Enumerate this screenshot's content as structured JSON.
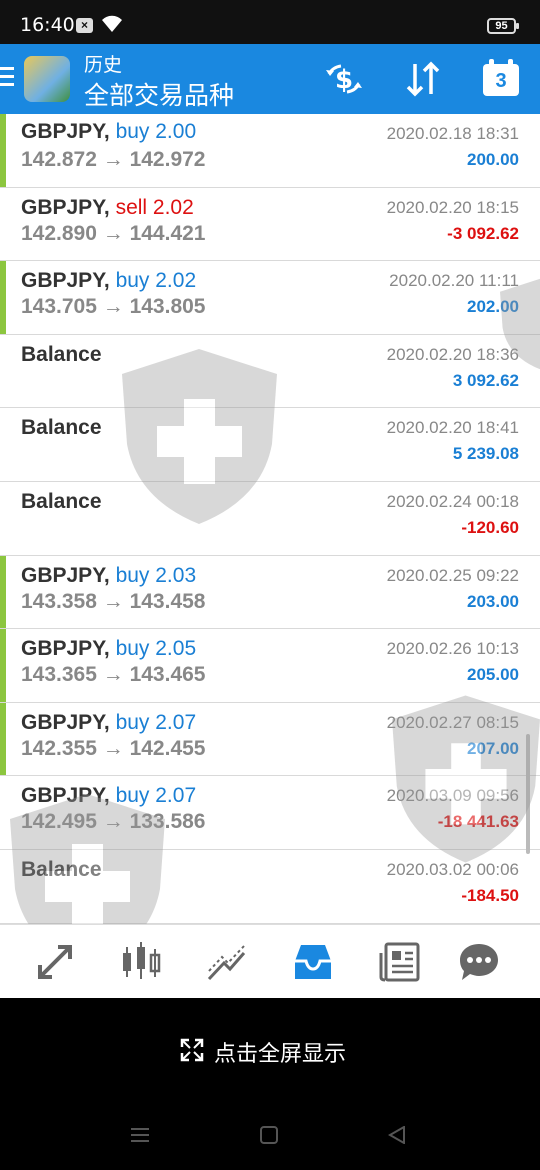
{
  "status": {
    "time": "16:40",
    "battery": "95",
    "notification": "×"
  },
  "appbar": {
    "title": "历史",
    "subtitle": "全部交易品种",
    "calendar_day": "3"
  },
  "rows": [
    {
      "type": "trade",
      "symbol": "GBPJPY,",
      "action": "buy 2.00",
      "side": "buy",
      "prices": "142.872 → 142.972",
      "date": "2020.02.18 18:31",
      "profit": "200.00",
      "sign": "pos"
    },
    {
      "type": "none",
      "symbol": "GBPJPY,",
      "action": "sell 2.02",
      "side": "sell",
      "prices": "142.890 → 144.421",
      "date": "2020.02.20 18:15",
      "profit": "-3 092.62",
      "sign": "neg"
    },
    {
      "type": "trade",
      "symbol": "GBPJPY,",
      "action": "buy 2.02",
      "side": "buy",
      "prices": "143.705 → 143.805",
      "date": "2020.02.20 11:11",
      "profit": "202.00",
      "sign": "pos"
    },
    {
      "type": "balance",
      "symbol": "Balance",
      "action": "",
      "side": "",
      "prices": "",
      "date": "2020.02.20 18:36",
      "profit": "3 092.62",
      "sign": "pos"
    },
    {
      "type": "balance",
      "symbol": "Balance",
      "action": "",
      "side": "",
      "prices": "",
      "date": "2020.02.20 18:41",
      "profit": "5 239.08",
      "sign": "pos"
    },
    {
      "type": "balance",
      "symbol": "Balance",
      "action": "",
      "side": "",
      "prices": "",
      "date": "2020.02.24 00:18",
      "profit": "-120.60",
      "sign": "neg"
    },
    {
      "type": "trade",
      "symbol": "GBPJPY,",
      "action": "buy 2.03",
      "side": "buy",
      "prices": "143.358 → 143.458",
      "date": "2020.02.25 09:22",
      "profit": "203.00",
      "sign": "pos"
    },
    {
      "type": "trade",
      "symbol": "GBPJPY,",
      "action": "buy 2.05",
      "side": "buy",
      "prices": "143.365 → 143.465",
      "date": "2020.02.26 10:13",
      "profit": "205.00",
      "sign": "pos"
    },
    {
      "type": "trade",
      "symbol": "GBPJPY,",
      "action": "buy 2.07",
      "side": "buy",
      "prices": "142.355 → 142.455",
      "date": "2020.02.27 08:15",
      "profit": "207.00",
      "sign": "pos"
    },
    {
      "type": "none",
      "symbol": "GBPJPY,",
      "action": "buy 2.07",
      "side": "buy",
      "prices": "142.495 → 133.586",
      "date": "2020.03.09 09:56",
      "profit": "-18 441.63",
      "sign": "neg"
    },
    {
      "type": "balance",
      "symbol": "Balance",
      "action": "",
      "side": "",
      "prices": "",
      "date": "2020.03.02 00:06",
      "profit": "-184.50",
      "sign": "neg"
    }
  ],
  "fullscreen": {
    "label": "点击全屏显示"
  },
  "colors": {
    "appbar": "#1a88e0",
    "buy": "#1a7fd4",
    "sell": "#dd1111",
    "profit_stripe": "#8cc63f"
  }
}
